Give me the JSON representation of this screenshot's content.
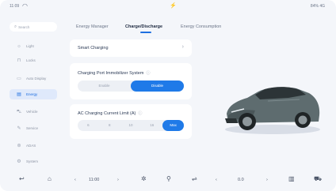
{
  "status": {
    "time": "11:09",
    "right": "84% 4G"
  },
  "sidebar": {
    "search_placeholder": "Search",
    "items": [
      {
        "label": "Light",
        "icon": "light-icon"
      },
      {
        "label": "Locks",
        "icon": "lock-icon"
      },
      {
        "label": "Auto Display",
        "icon": "display-icon"
      },
      {
        "label": "Energy",
        "icon": "energy-icon",
        "active": true
      },
      {
        "label": "Vehicle",
        "icon": "vehicle-icon"
      },
      {
        "label": "Service",
        "icon": "service-icon"
      },
      {
        "label": "ADAS",
        "icon": "adas-icon"
      },
      {
        "label": "System",
        "icon": "system-icon"
      }
    ]
  },
  "tabs": [
    {
      "label": "Energy Manager"
    },
    {
      "label": "Charge/Discharge",
      "active": true
    },
    {
      "label": "Energy Consumption"
    }
  ],
  "smart_charging": {
    "label": "Smart Charging"
  },
  "immobilizer": {
    "title": "Charging Port Immobilizer System",
    "options": [
      "Enable",
      "Disable"
    ],
    "selected": "Disable"
  },
  "ac_limit": {
    "title": "AC Charging Current Limit (A)",
    "options": [
      "6",
      "8",
      "10",
      "16",
      "Max"
    ],
    "selected": "Max"
  },
  "dock": {
    "clock": "11:00",
    "fan_value": "0.0"
  },
  "colors": {
    "accent": "#1f7ae8",
    "active_bg": "#dfe9fb"
  }
}
